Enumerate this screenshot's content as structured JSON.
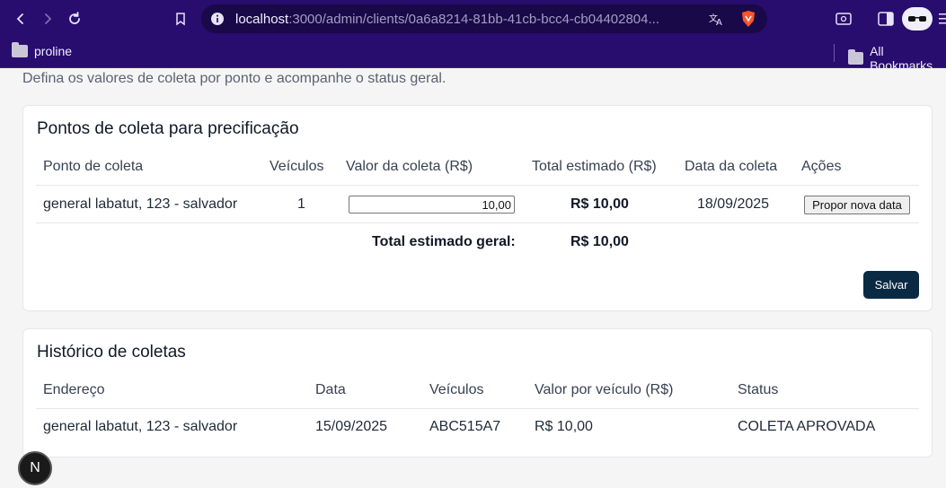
{
  "browser": {
    "url_host": "localhost",
    "url_rest": ":3000/admin/clients/0a6a8214-81bb-41cb-bcc4-cb04402804...",
    "bookmarks": [
      "proline"
    ],
    "all_bookmarks_label": "All Bookmarks"
  },
  "page": {
    "subtitle": "Defina os valores de coleta por ponto e acompanhe o status geral.",
    "nextjs_badge": "N"
  },
  "pricing": {
    "title": "Pontos de coleta para precificação",
    "headers": [
      "Ponto de coleta",
      "Veículos",
      "Valor da coleta (R$)",
      "Total estimado (R$)",
      "Data da coleta",
      "Ações"
    ],
    "rows": [
      {
        "point": "general labatut, 123 - salvador",
        "vehicles": "1",
        "value": "10,00",
        "total": "R$ 10,00",
        "date": "18/09/2025",
        "action_label": "Propor nova data"
      }
    ],
    "grand_total_label": "Total estimado geral:",
    "grand_total_value": "R$ 10,00",
    "save_label": "Salvar"
  },
  "history": {
    "title": "Histórico de coletas",
    "headers": [
      "Endereço",
      "Data",
      "Veículos",
      "Valor por veículo (R$)",
      "Status"
    ],
    "rows": [
      {
        "address": "general labatut, 123 - salvador",
        "date": "15/09/2025",
        "vehicles": "ABC515A7",
        "value": "R$ 10,00",
        "status": "COLETA APROVADA"
      }
    ]
  }
}
